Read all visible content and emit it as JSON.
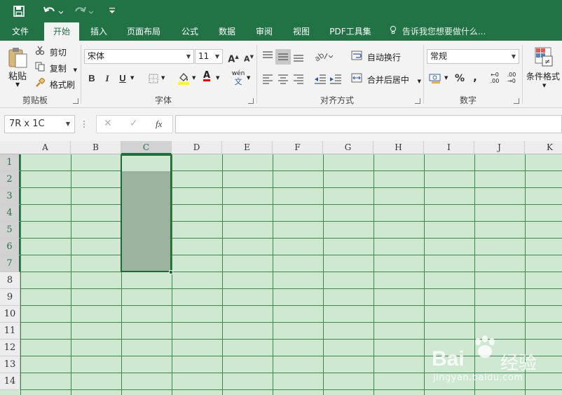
{
  "titlebar": {
    "icons": [
      "save-icon",
      "undo-icon",
      "redo-icon",
      "customize-icon"
    ]
  },
  "tabs": [
    {
      "label": "文件",
      "active": false
    },
    {
      "label": "开始",
      "active": true
    },
    {
      "label": "插入",
      "active": false
    },
    {
      "label": "页面布局",
      "active": false
    },
    {
      "label": "公式",
      "active": false
    },
    {
      "label": "数据",
      "active": false
    },
    {
      "label": "审阅",
      "active": false
    },
    {
      "label": "视图",
      "active": false
    },
    {
      "label": "PDF工具集",
      "active": false
    }
  ],
  "tell_me": "告诉我您想要做什么...",
  "clipboard": {
    "paste": "粘贴",
    "cut": "剪切",
    "copy": "复制",
    "format_painter": "格式刷",
    "group_label": "剪贴板"
  },
  "font": {
    "name": "宋体",
    "size": "11",
    "grow": "A",
    "shrink": "A",
    "bold": "B",
    "italic": "I",
    "underline": "U",
    "color_letter": "A",
    "pinyin_top": "wén",
    "pinyin_bottom": "文",
    "group_label": "字体"
  },
  "alignment": {
    "wrap_text": "自动换行",
    "merge_center": "合并后居中",
    "group_label": "对齐方式"
  },
  "number": {
    "format": "常规",
    "percent": "%",
    "comma": ",",
    "inc_decimal_top": "←0",
    "inc_decimal_bottom": ".00",
    "dec_decimal_top": ".00",
    "dec_decimal_bottom": "→0",
    "group_label": "数字"
  },
  "styles": {
    "conditional_format": "条件格式"
  },
  "formula_bar": {
    "name_box": "7R x 1C",
    "cancel": "✕",
    "enter": "✓",
    "fx": "fx",
    "value": ""
  },
  "sheet": {
    "columns": [
      "A",
      "B",
      "C",
      "D",
      "E",
      "F",
      "G",
      "H",
      "I",
      "J",
      "K"
    ],
    "rows": [
      "1",
      "2",
      "3",
      "4",
      "5",
      "6",
      "7",
      "8",
      "9",
      "10",
      "11",
      "12",
      "13",
      "14"
    ],
    "selected_column": "C",
    "selected_rows": [
      "1",
      "2",
      "3",
      "4",
      "5",
      "6",
      "7"
    ],
    "cell_fill": "#cfe8d1",
    "gridline_color": "#3b8a4c",
    "selection_fill": "#9bb39f"
  },
  "watermark": {
    "brand": "Bai",
    "brand_end": "经验",
    "url": "jingyan.baidu.com"
  },
  "colors": {
    "accent": "#217346",
    "highlight_yellow": "#ffff00",
    "font_red": "#ff0000"
  }
}
